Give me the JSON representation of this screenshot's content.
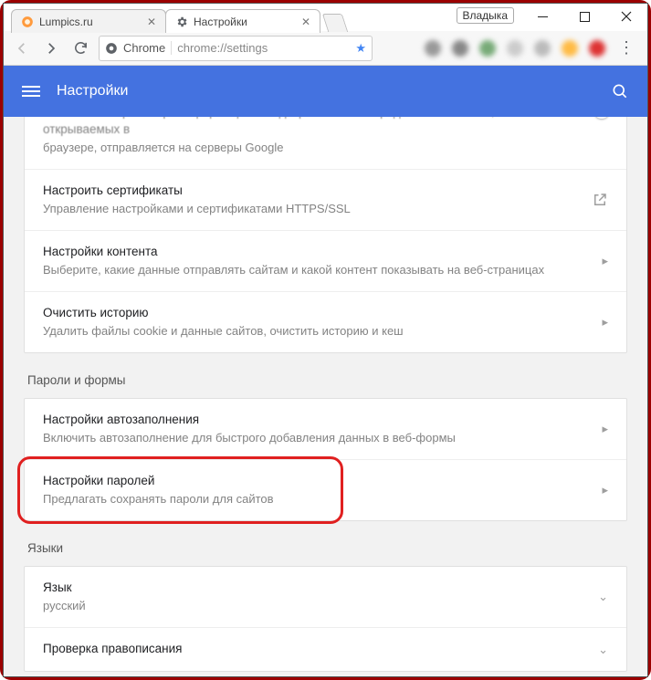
{
  "window": {
    "user_label": "Владыка",
    "tabs": [
      {
        "title": "Lumpics.ru",
        "active": false
      },
      {
        "title": "Настройки",
        "active": true
      }
    ]
  },
  "toolbar": {
    "chrome_label": "Chrome",
    "url_display": "chrome://settings"
  },
  "header": {
    "title": "Настройки"
  },
  "content": {
    "top_partial_sub": "браузере, отправляется на серверы Google",
    "card1": [
      {
        "title": "Настроить сертификаты",
        "sub": "Управление настройками и сертификатами HTTPS/SSL",
        "icon": "external"
      },
      {
        "title": "Настройки контента",
        "sub": "Выберите, какие данные отправлять сайтам и какой контент показывать на веб-страницах",
        "icon": "arrow"
      },
      {
        "title": "Очистить историю",
        "sub": "Удалить файлы cookie и данные сайтов, очистить историю и кеш",
        "icon": "arrow"
      }
    ],
    "section_passwords": "Пароли и формы",
    "card2": [
      {
        "title": "Настройки автозаполнения",
        "sub": "Включить автозаполнение для быстрого добавления данных в веб-формы",
        "icon": "arrow"
      },
      {
        "title": "Настройки паролей",
        "sub": "Предлагать сохранять пароли для сайтов",
        "icon": "arrow",
        "highlight": true
      }
    ],
    "section_languages": "Языки",
    "card3": [
      {
        "title": "Язык",
        "sub": "русский",
        "icon": "caret"
      },
      {
        "title": "Проверка правописания",
        "sub": "",
        "icon": "caret"
      }
    ]
  }
}
